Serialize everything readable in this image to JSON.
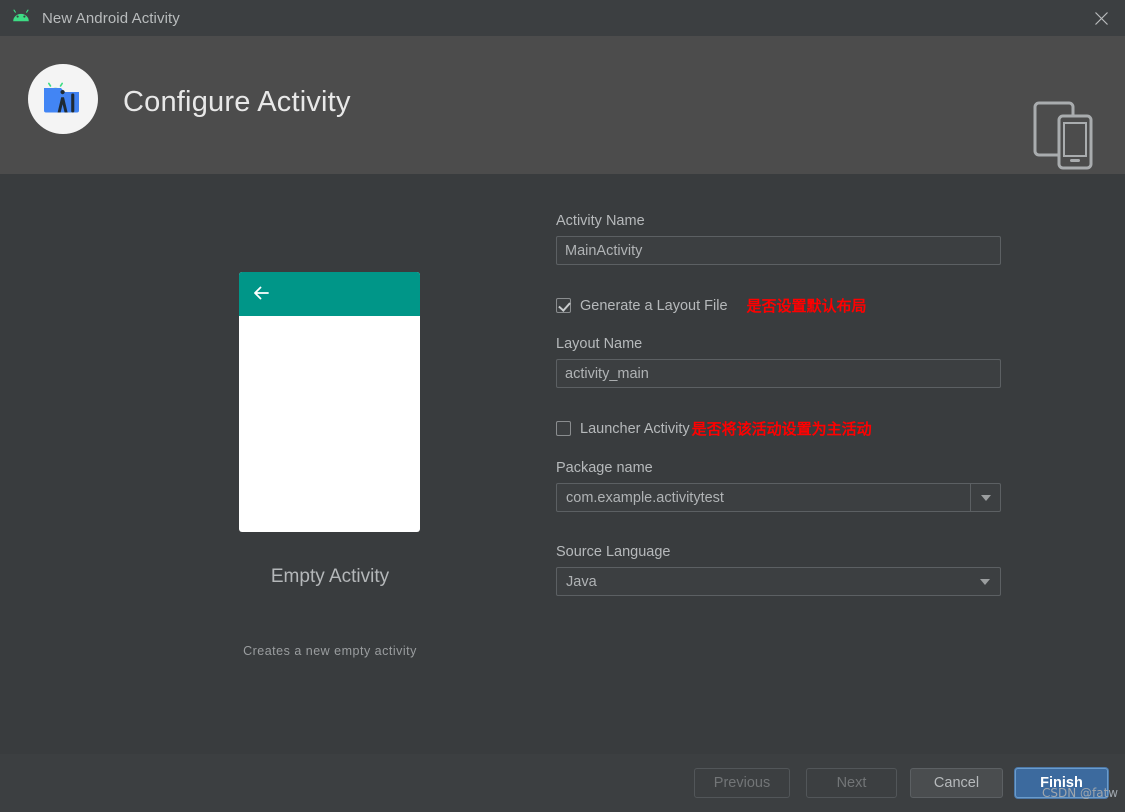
{
  "window": {
    "title": "New Android Activity",
    "icon": "android-head-icon",
    "close_label": "close-icon"
  },
  "header": {
    "title": "Configure Activity",
    "wizard_icon": "android-studio-activity-icon",
    "device_icon": "tablet-and-phone-icon"
  },
  "preview": {
    "template_name": "Empty Activity",
    "description": "Creates a new empty activity",
    "appbar_color": "#009688",
    "back_arrow_icon": "back-arrow-icon"
  },
  "form": {
    "activity_name": {
      "label": "Activity Name",
      "value": "MainActivity",
      "placeholder": "MainActivity"
    },
    "generate_layout": {
      "label": "Generate a Layout File",
      "checked": true,
      "annotation": "是否设置默认布局"
    },
    "layout_name": {
      "label": "Layout Name",
      "value": "activity_main",
      "placeholder": "activity_main"
    },
    "launcher_activity": {
      "label": "Launcher Activity",
      "checked": false,
      "annotation": "是否将该活动设置为主活动"
    },
    "package_name": {
      "label": "Package name",
      "value": "com.example.activitytest"
    },
    "source_language": {
      "label": "Source Language",
      "value": "Java"
    }
  },
  "footer": {
    "previous": "Previous",
    "next": "Next",
    "cancel": "Cancel",
    "finish": "Finish"
  },
  "watermark": "CSDN @fatw",
  "colors": {
    "annotation_red": "#ff0000",
    "primary_blue": "#3c6a9e",
    "appbar_teal": "#009688",
    "android_green": "#3ddc84"
  }
}
